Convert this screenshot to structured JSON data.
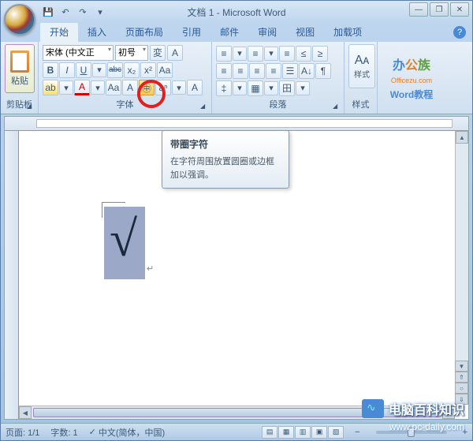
{
  "title": "文档 1 - Microsoft Word",
  "qat": {
    "save": "💾",
    "undo": "↶",
    "redo": "↷",
    "more": "▾"
  },
  "win": {
    "min": "—",
    "max": "❐",
    "close": "✕"
  },
  "tabs": [
    "开始",
    "插入",
    "页面布局",
    "引用",
    "邮件",
    "审阅",
    "视图",
    "加载项"
  ],
  "help": "?",
  "ribbon": {
    "clipboard": {
      "paste": "粘贴",
      "label": "剪贴板"
    },
    "font": {
      "name": "宋体 (中文正",
      "size": "初号",
      "grow": "A",
      "shrink": "A",
      "clear": "Aa",
      "bold": "B",
      "italic": "I",
      "underline": "U",
      "strike": "abc",
      "sub": "x₂",
      "sup": "x²",
      "case": "Aa",
      "highlight": "ab",
      "color": "A",
      "aa": "Aa",
      "charborder": "A",
      "enclose": "㊥",
      "phonetic": "aⁿ",
      "a2": "A",
      "wen": "変",
      "boxA": "A",
      "label": "字体"
    },
    "para": {
      "bullets": "≡",
      "numbers": "≡",
      "multilevel": "≡",
      "indentL": "≤",
      "indentR": "≥",
      "sort": "A↓",
      "showmarks": "¶",
      "alignL": "≡",
      "alignC": "≡",
      "alignR": "≡",
      "justify": "≡",
      "dist": "☰",
      "spacing": "‡",
      "shading": "▦",
      "borders": "田",
      "label": "段落"
    },
    "styles": {
      "btn": "Aᴀ",
      "label": "样式"
    },
    "watermark": {
      "logo1": "办",
      "logo2": "公",
      "logo3": "族",
      "url": "Officezu.com",
      "sub": "Word教程"
    }
  },
  "tooltip": {
    "title": "带圈字符",
    "desc": "在字符周围放置圆圈或边框加以强调。"
  },
  "document": {
    "symbol": "√",
    "para_mark": "↵"
  },
  "status": {
    "page": "页面: 1/1",
    "words": "字数: 1",
    "lang_icon": "✓",
    "lang": "中文(简体，中国)",
    "views": [
      "▤",
      "▦",
      "▥",
      "▣",
      "▧"
    ],
    "zoom_minus": "−",
    "zoom_plus": "+"
  },
  "footer_wm": {
    "text": "电脑百科知识",
    "url": "www.pc-daily.com"
  }
}
